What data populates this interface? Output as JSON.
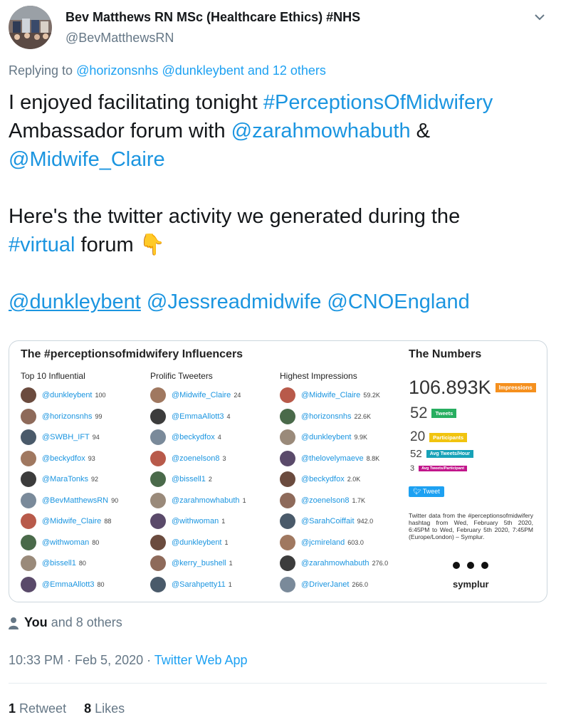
{
  "author": {
    "display_name": "Bev Matthews RN MSc (Healthcare Ethics) #NHS",
    "handle": "@BevMatthewsRN"
  },
  "reply": {
    "prefix": "Replying to",
    "handle1": "@horizonsnhs",
    "handle2": "@dunkleybent",
    "others": "and 12 others"
  },
  "tweet": {
    "l1_text": "I enjoyed facilitating tonight ",
    "l1_tag": "#PerceptionsOfMidwifery",
    "l2_text": " Ambassador forum with ",
    "l2_mention": "@zarahmowhabuth",
    "l2_amp": " &",
    "l3_mention": "@Midwife_Claire",
    "l5_text": "Here's the twitter activity we generated during the",
    "l6_tag": "#virtual",
    "l6_text": " forum ",
    "l6_emoji": "👇",
    "l8_m1": "@dunkleybent",
    "l8_m2": "@Jessreadmidwife",
    "l8_m3": "@CNOEngland"
  },
  "card": {
    "title": "The #perceptionsofmidwifery Influencers",
    "columns": [
      {
        "title": "Top 10 Influential",
        "rows": [
          {
            "name": "@dunkleybent",
            "value": "100"
          },
          {
            "name": "@horizonsnhs",
            "value": "99"
          },
          {
            "name": "@SWBH_IFT",
            "value": "94"
          },
          {
            "name": "@beckydfox",
            "value": "93"
          },
          {
            "name": "@MaraTonks",
            "value": "92"
          },
          {
            "name": "@BevMatthewsRN",
            "value": "90"
          },
          {
            "name": "@Midwife_Claire",
            "value": "88"
          },
          {
            "name": "@withwoman",
            "value": "80"
          },
          {
            "name": "@bissell1",
            "value": "80"
          },
          {
            "name": "@EmmaAllott3",
            "value": "80"
          }
        ]
      },
      {
        "title": "Prolific Tweeters",
        "rows": [
          {
            "name": "@Midwife_Claire",
            "value": "24"
          },
          {
            "name": "@EmmaAllott3",
            "value": "4"
          },
          {
            "name": "@beckydfox",
            "value": "4"
          },
          {
            "name": "@zoenelson8",
            "value": "3"
          },
          {
            "name": "@bissell1",
            "value": "2"
          },
          {
            "name": "@zarahmowhabuth",
            "value": "1"
          },
          {
            "name": "@withwoman",
            "value": "1"
          },
          {
            "name": "@dunkleybent",
            "value": "1"
          },
          {
            "name": "@kerry_bushell",
            "value": "1"
          },
          {
            "name": "@Sarahpetty11",
            "value": "1"
          }
        ]
      },
      {
        "title": "Highest Impressions",
        "rows": [
          {
            "name": "@Midwife_Claire",
            "value": "59.2K"
          },
          {
            "name": "@horizonsnhs",
            "value": "22.6K"
          },
          {
            "name": "@dunkleybent",
            "value": "9.9K"
          },
          {
            "name": "@thelovelymaeve",
            "value": "8.8K"
          },
          {
            "name": "@beckydfox",
            "value": "2.0K"
          },
          {
            "name": "@zoenelson8",
            "value": "1.7K"
          },
          {
            "name": "@SarahCoiffait",
            "value": "942.0"
          },
          {
            "name": "@jcmireland",
            "value": "603.0"
          },
          {
            "name": "@zarahmowhabuth",
            "value": "276.0"
          },
          {
            "name": "@DriverJanet",
            "value": "266.0"
          }
        ]
      }
    ],
    "numbers": {
      "title": "The Numbers",
      "impressions_value": "106.893K",
      "impressions_label": "Impressions",
      "tweets_value": "52",
      "tweets_label": "Tweets",
      "participants_value": "20",
      "participants_label": "Participants",
      "avg_hour_value": "52",
      "avg_hour_label": "Avg Tweets/Hour",
      "avg_part_value": "3",
      "avg_part_label": "Avg Tweets/Participant",
      "tweet_button": "Tweet",
      "disclaimer": "Twitter data from the #perceptionsofmidwifery hashtag from Wed, February 5th 2020, 6:45PM to Wed, February 5th 2020, 7:45PM (Europe/London) – Symplur.",
      "brand": "symplur"
    },
    "colors": {
      "impressions": "#f5901e",
      "tweets": "#27ae60",
      "participants": "#f1c40f",
      "avg_hour": "#17a2b8",
      "avg_part": "#c2168b"
    }
  },
  "likers": {
    "you": "You",
    "others": "and 8 others"
  },
  "timestamp": {
    "time": "10:33 PM · Feb 5, 2020 · ",
    "source": "Twitter Web App"
  },
  "stats": {
    "retweets_count": "1",
    "retweets_label": "Retweet",
    "likes_count": "8",
    "likes_label": "Likes"
  }
}
